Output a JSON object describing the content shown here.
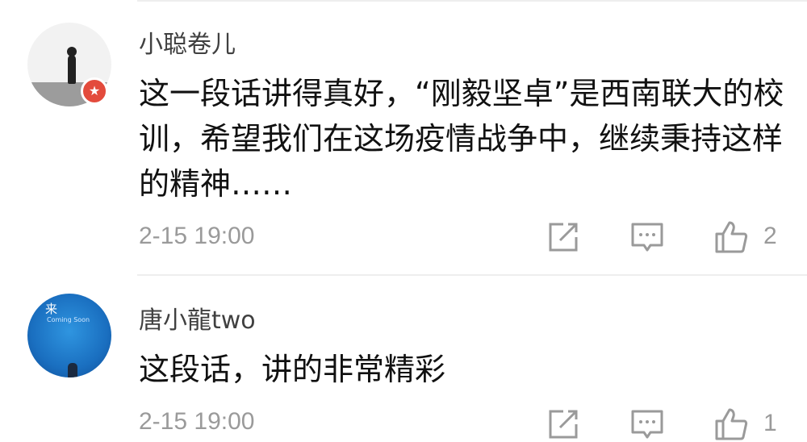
{
  "comments": [
    {
      "username": "小聪卷儿",
      "text": "这一段话讲得真好，“刚毅坚卓”是西南联大的校训，希望我们在这场疫情战争中，继续秉持这样的精神……",
      "timestamp": "2-15 19:00",
      "likes": "2",
      "badge_icon": "star-icon",
      "avatar_icon": "avatar-image"
    },
    {
      "username": "唐小龍two",
      "text": "这段话，讲的非常精彩",
      "timestamp": "2-15 19:00",
      "likes": "1",
      "avatar_icon": "avatar-image",
      "avatar_text": {
        "top": "来",
        "sub": "Coming Soon"
      }
    }
  ],
  "colors": {
    "text": "#111111",
    "meta": "#9a9a9a",
    "badge": "#e34b3c",
    "divider": "#eeeeee"
  }
}
